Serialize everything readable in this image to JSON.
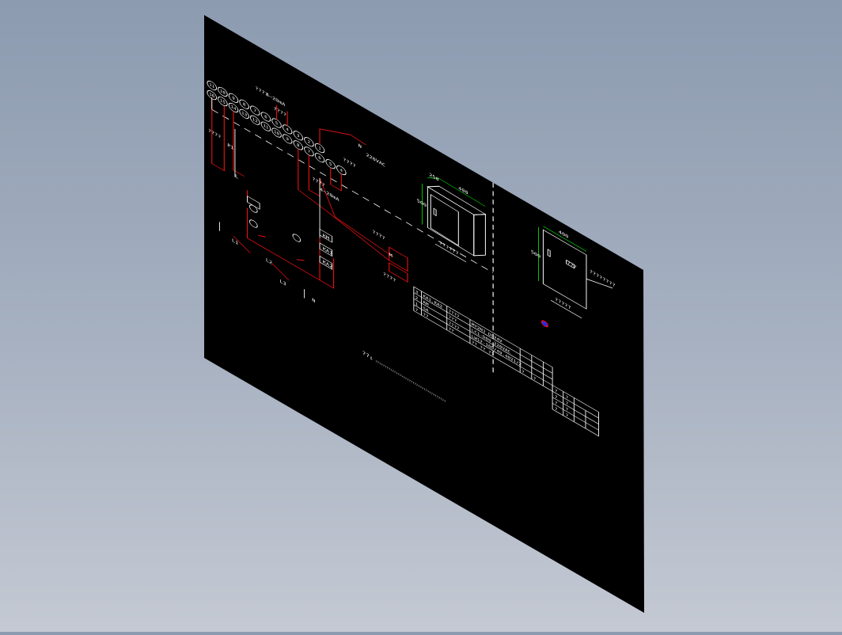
{
  "colors": {
    "background_top": "#8c9bb0",
    "background_bottom": "#c4c9d3",
    "sheet": "#000000",
    "wire_red": "#e01010",
    "line_white": "#ffffff",
    "dim_green": "#00e000",
    "marker_blue": "#1a2cff"
  },
  "schematic": {
    "terminals_top": [
      "11",
      "10",
      "9",
      "8",
      "7",
      "6",
      "5",
      "4",
      "3",
      "2",
      "1"
    ],
    "terminals_bottom": [
      "16",
      "15",
      "14",
      "13",
      "12",
      "11",
      "10",
      "9",
      "8",
      "7",
      "6",
      "5",
      "4"
    ],
    "label_4_20ma_top": "4~20mA",
    "label_4_20ma_bottom": "4~20mA",
    "label_q1": "????",
    "label_q2": "????",
    "label_q3": "????",
    "label_q4": "????",
    "label_q5": "????",
    "label_q6": "????",
    "label_220vac": "220VAC",
    "label_n": "N",
    "label_l": "L",
    "label_p1": "P1",
    "label_m": "M",
    "label_qs": "????",
    "label_km": "KM",
    "label_ka1": "KA1",
    "label_ka2": "KA2",
    "label_l1": "L1",
    "label_l2": "L2",
    "label_l3": "L3",
    "label_n2": "N"
  },
  "enclosure": {
    "dim_depth": "250",
    "dim_width": "400",
    "dim_height": "500",
    "caption": "??????",
    "front_dim_width": "400",
    "front_dim_height": "500",
    "front_caption": "?????",
    "front_label": "???",
    "callout": "????????"
  },
  "bom_table": {
    "rows": [
      [
        "3",
        "KA1,KA2",
        "????",
        "MY2NJ  DC24V",
        "",
        "",
        ""
      ],
      [
        "2",
        "KM",
        "???",
        "LC1-D09  220VAC",
        "",
        "",
        ""
      ],
      [
        "1",
        "SA",
        "????",
        "LW12-16D/49.4021/2",
        "",
        "",
        ""
      ],
      [
        "?",
        "??",
        "??",
        "??   ??   ??",
        "?",
        "?",
        ""
      ]
    ],
    "small_rows": [
      [
        "?",
        "?",
        "",
        ""
      ],
      [
        "?",
        "?",
        "",
        ""
      ],
      [
        "?",
        "?",
        "",
        ""
      ],
      [
        "?",
        "?",
        "",
        ""
      ]
    ]
  },
  "sheet_note": "??:",
  "sheet_note_detail": "1. ??????????????????????????????????????"
}
